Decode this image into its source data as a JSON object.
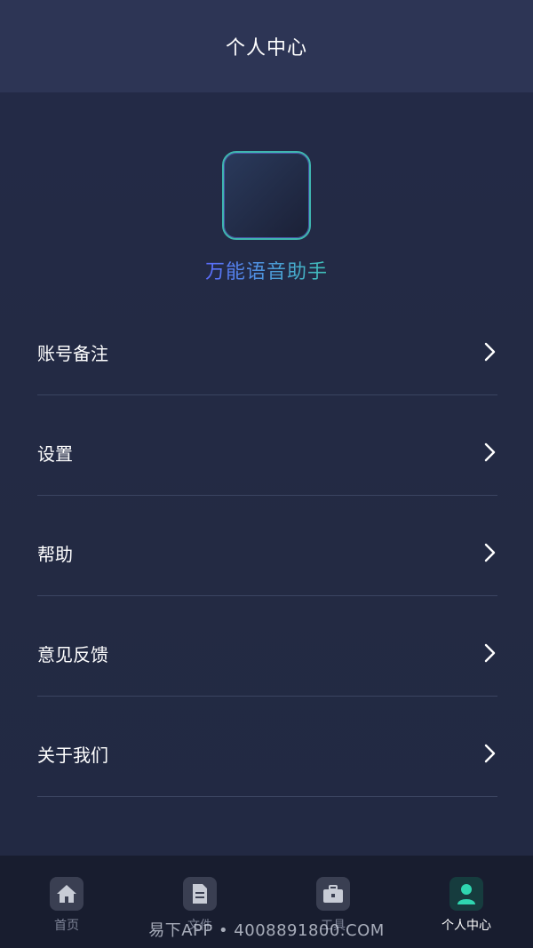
{
  "header": {
    "title": "个人中心"
  },
  "app": {
    "name": "万能语音助手"
  },
  "menu": {
    "items": [
      {
        "label": "账号备注"
      },
      {
        "label": "设置"
      },
      {
        "label": "帮助"
      },
      {
        "label": "意见反馈"
      },
      {
        "label": "关于我们"
      }
    ]
  },
  "tabbar": {
    "items": [
      {
        "label": "首页",
        "icon": "home-icon"
      },
      {
        "label": "文件",
        "icon": "file-icon"
      },
      {
        "label": "工具",
        "icon": "toolbox-icon"
      },
      {
        "label": "个人中心",
        "icon": "person-icon",
        "active": true
      }
    ]
  },
  "watermark": {
    "text": "易下APP • 4008891800.COM"
  },
  "colors": {
    "background": "#232a44",
    "header": "#2d3555",
    "tabbar": "#181d2f",
    "accent": "#2fd6b0",
    "app_name_start": "#5b6cff",
    "app_name_end": "#3fc2b8"
  }
}
